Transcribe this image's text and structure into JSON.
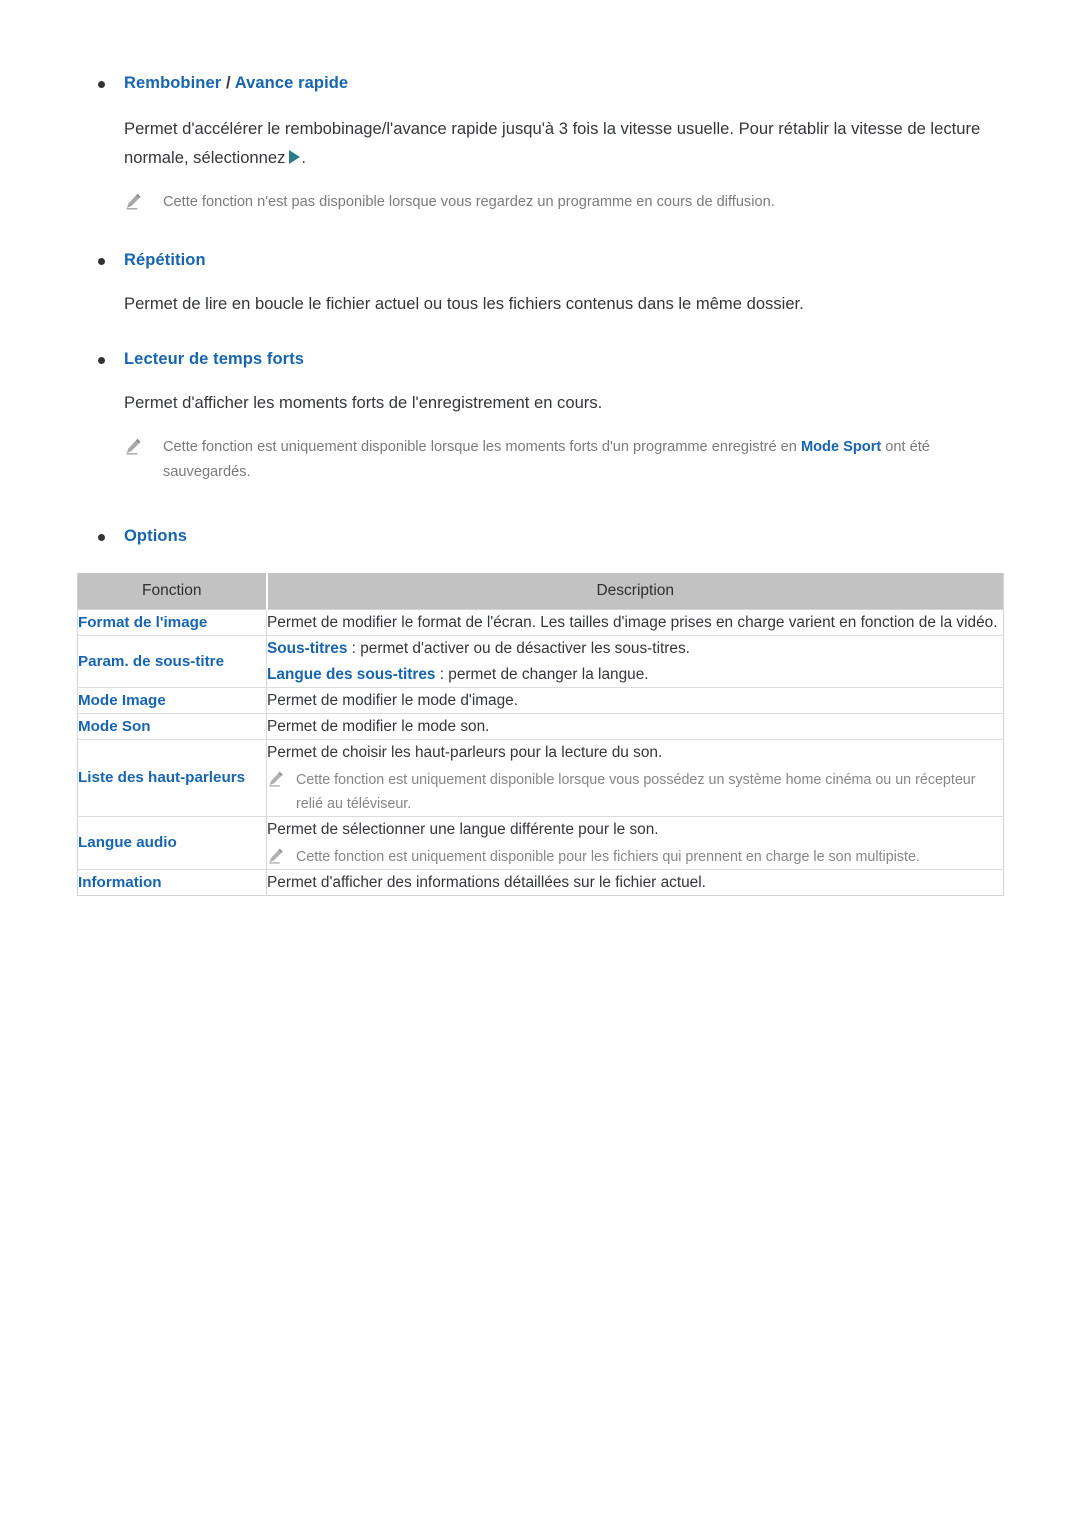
{
  "sections": [
    {
      "heading_parts": [
        {
          "text": "Rembobiner",
          "style": "blue"
        },
        {
          "text": " / ",
          "style": "sep"
        },
        {
          "text": "Avance rapide",
          "style": "blue"
        }
      ],
      "heading_plain": "Rembobiner / Avance rapide",
      "body_before_glyph": "Permet d'accélérer le rembobinage/l'avance rapide jusqu'à 3 fois la vitesse usuelle. Pour rétablir la vitesse de lecture normale, sélectionnez",
      "body_after_glyph": ".",
      "note": "Cette fonction n'est pas disponible lorsque vous regardez un programme en cours de diffusion."
    },
    {
      "heading_plain": "Répétition",
      "body": "Permet de lire en boucle le fichier actuel ou tous les fichiers contenus dans le même dossier."
    },
    {
      "heading_plain": "Lecteur de temps forts",
      "body": "Permet d'afficher les moments forts de l'enregistrement en cours.",
      "note_part1": "Cette fonction est uniquement disponible lorsque les moments forts d'un programme enregistré en ",
      "note_bold": "Mode Sport",
      "note_part2": " ont été sauvegardés."
    },
    {
      "heading_plain": "Options"
    }
  ],
  "options_table": {
    "columns": [
      "Fonction",
      "Description"
    ],
    "rows": [
      {
        "fonction": "Format de l'image",
        "lines": [
          {
            "type": "text",
            "text": "Permet de modifier le format de l'écran. Les tailles d'image prises en charge varient en fonction de la vidéo."
          }
        ]
      },
      {
        "fonction": "Param. de sous-titre",
        "lines": [
          {
            "type": "rich",
            "bold": "Sous-titres",
            "rest": " : permet d'activer ou de désactiver les sous-titres."
          },
          {
            "type": "rich",
            "bold": "Langue des sous-titres",
            "rest": " : permet de changer la langue."
          }
        ]
      },
      {
        "fonction": "Mode Image",
        "lines": [
          {
            "type": "text",
            "text": "Permet de modifier le mode d'image."
          }
        ]
      },
      {
        "fonction": "Mode Son",
        "lines": [
          {
            "type": "text",
            "text": "Permet de modifier le mode son."
          }
        ]
      },
      {
        "fonction": "Liste des haut-parleurs",
        "lines": [
          {
            "type": "text",
            "text": "Permet de choisir les haut-parleurs pour la lecture du son."
          },
          {
            "type": "note",
            "text": "Cette fonction est uniquement disponible lorsque vous possédez un système home cinéma ou un récepteur relié au téléviseur."
          }
        ]
      },
      {
        "fonction": "Langue audio",
        "lines": [
          {
            "type": "text",
            "text": "Permet de sélectionner une langue différente pour le son."
          },
          {
            "type": "note",
            "text": "Cette fonction est uniquement disponible pour les fichiers qui prennent en charge le son multipiste."
          }
        ]
      },
      {
        "fonction": "Information",
        "lines": [
          {
            "type": "text",
            "text": "Permet d'afficher des informations détaillées sur le fichier actuel."
          }
        ]
      }
    ]
  },
  "colors": {
    "heading_blue": "#1765b0",
    "body_text": "#33363a",
    "note_gray": "#7b7b7b",
    "table_header_bg": "#c2c2c2",
    "table_border": "#d7d7d7",
    "play_glyph_teal": "#2b7c85"
  },
  "icons": {
    "bullet": "bullet-dot",
    "note": "pencil-note-icon",
    "play": "play-triangle-icon"
  }
}
